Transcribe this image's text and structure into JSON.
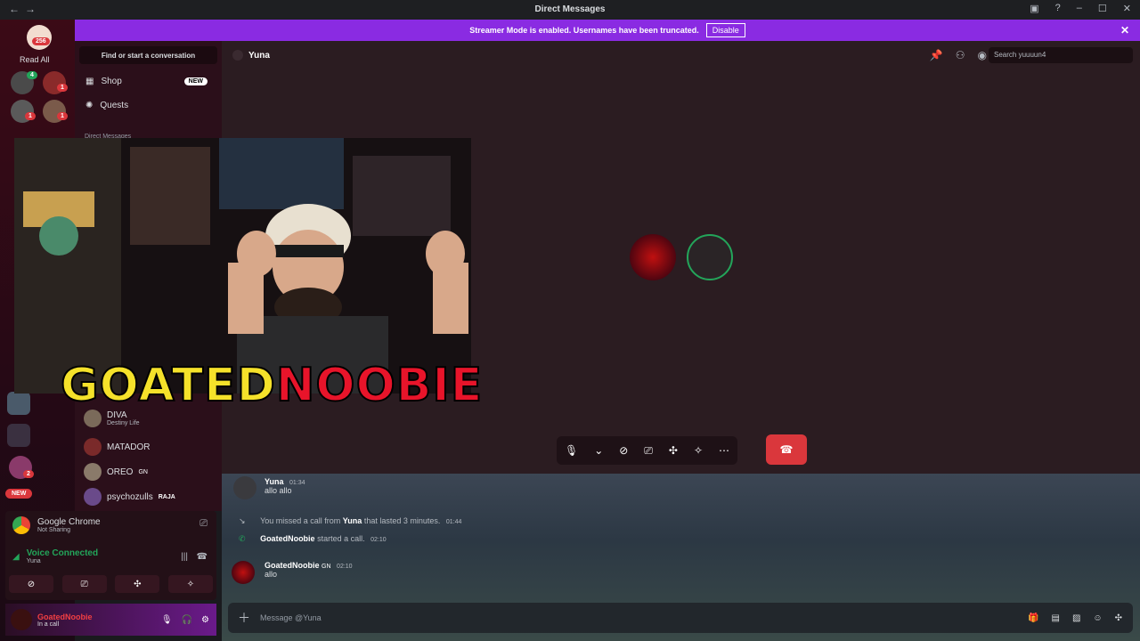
{
  "window": {
    "title": "Direct Messages"
  },
  "banner": {
    "text": "Streamer Mode is enabled. Usernames have been truncated.",
    "disable_label": "Disable"
  },
  "servers": {
    "unread_count": "256",
    "read_all_label": "Read All",
    "new_label": "NEW",
    "badges": [
      "4",
      "1",
      "1",
      "1",
      "2"
    ]
  },
  "sidebar": {
    "search_label": "Find or start a conversation",
    "shop_label": "Shop",
    "shop_badge": "NEW",
    "quests_label": "Quests",
    "dm_header": "Direct Messages",
    "dms": [
      {
        "name": "DIVA",
        "status": "Destiny Life"
      },
      {
        "name": "MATADOR",
        "status": ""
      },
      {
        "name": "OREO",
        "status": "",
        "tag": "GN"
      },
      {
        "name": "psychozulls",
        "status": "",
        "tag": "RAJA"
      }
    ]
  },
  "header": {
    "name": "Yuna",
    "search_placeholder": "Search yuuuun4"
  },
  "stream_overlay": {
    "logo_part1": "GOATED",
    "logo_part2": "NOOBIE"
  },
  "chat": {
    "messages": [
      {
        "author": "Yuna",
        "time": "01:34",
        "text": "allo allo"
      },
      {
        "system_text": "You missed a call from",
        "system_name": "Yuna",
        "system_suffix": "that lasted 3 minutes.",
        "time": "01:44"
      },
      {
        "author": "GoatedNoobie",
        "system_suffix": "started a call.",
        "time": "02:10"
      },
      {
        "author": "GoatedNoobie",
        "tag": "GN",
        "time": "02:10",
        "text": "allo"
      }
    ],
    "composer_placeholder": "Message @Yuna"
  },
  "voice_panel": {
    "app_name": "Google Chrome",
    "app_status": "Not Sharing",
    "voice_status": "Voice Connected",
    "voice_channel": "Yuna"
  },
  "user": {
    "name": "GoatedNoobie",
    "status": "In a call"
  },
  "colors": {
    "accent": "#8a2be2",
    "danger": "#da373c",
    "online": "#23a55a"
  }
}
